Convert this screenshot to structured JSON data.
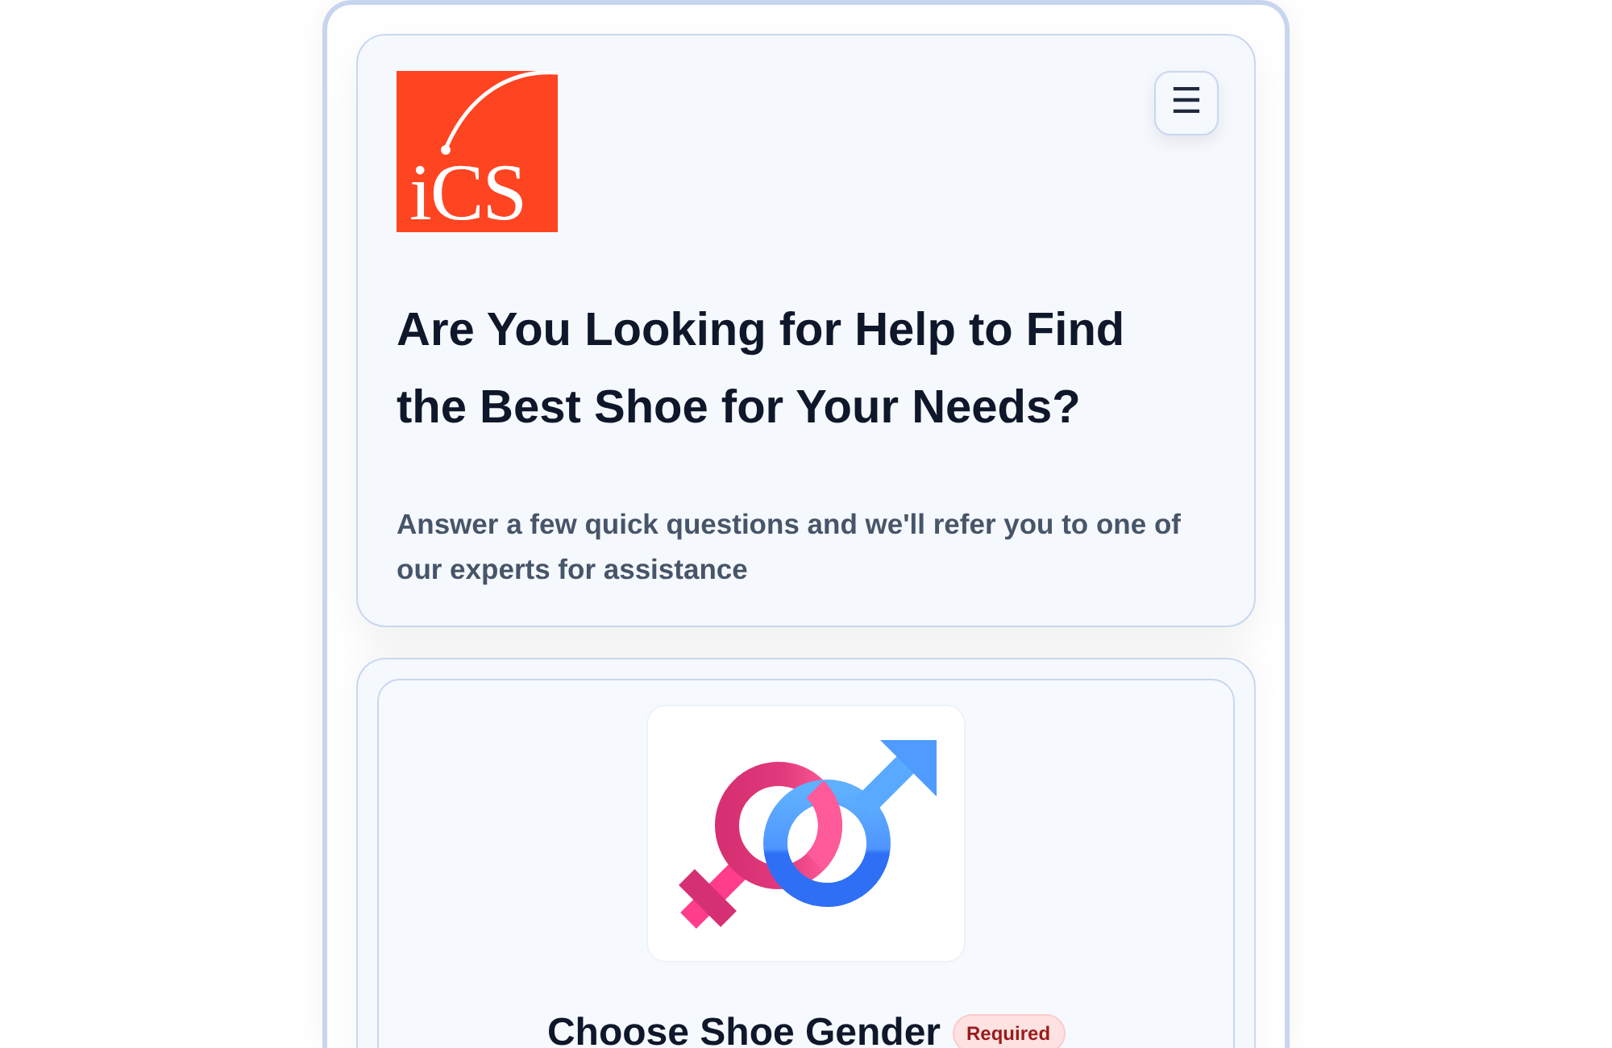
{
  "header": {
    "logo_text": "iCS",
    "menu_button": "☰",
    "title": "Are You Looking for Help to Find the Best Shoe for Your Needs?",
    "subtitle": "Answer a few quick questions and we'll refer you to one of our experts for assistance"
  },
  "question": {
    "title": "Choose Shoe Gender",
    "badge": "Required"
  }
}
